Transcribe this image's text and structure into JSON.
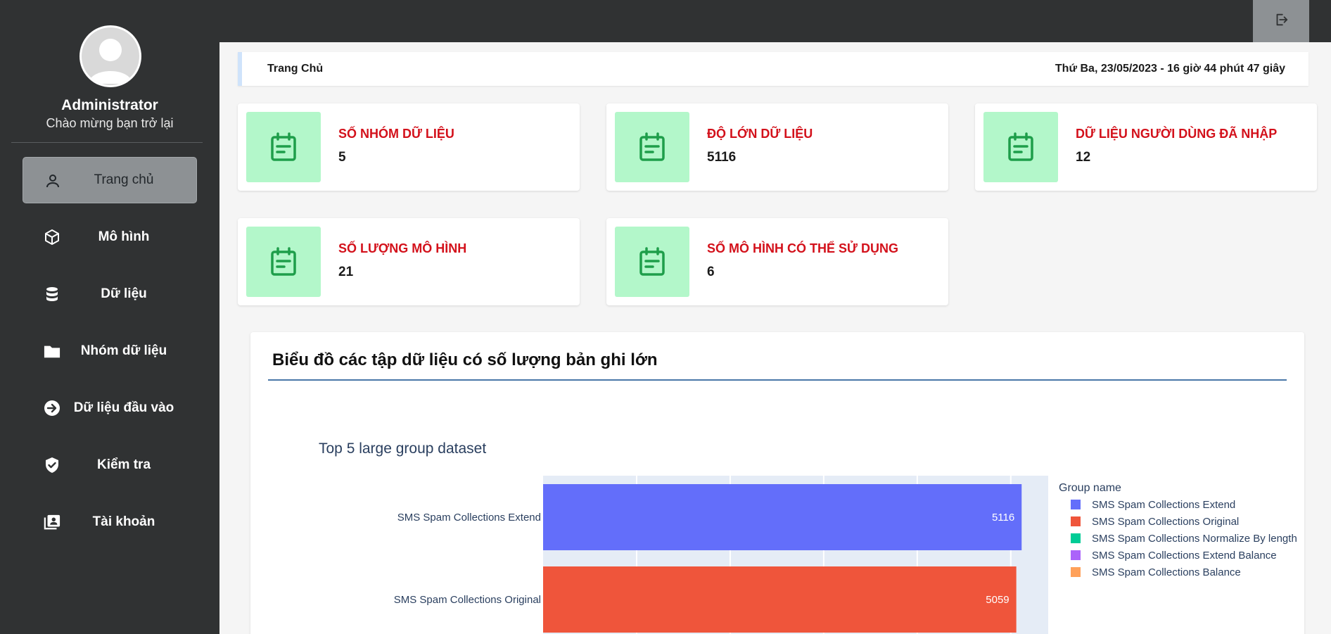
{
  "sidebar": {
    "admin_name": "Administrator",
    "welcome": "Chào mừng bạn trở lại",
    "items": [
      {
        "label": "Trang chủ",
        "icon": "user-icon",
        "active": true
      },
      {
        "label": "Mô hình",
        "icon": "cube-icon"
      },
      {
        "label": "Dữ liệu",
        "icon": "database-icon"
      },
      {
        "label": "Nhóm dữ liệu",
        "icon": "folder-icon"
      },
      {
        "label": "Dữ liệu đầu vào",
        "icon": "arrow-in-icon"
      },
      {
        "label": "Kiểm tra",
        "icon": "shield-check-icon"
      },
      {
        "label": "Tài khoản",
        "icon": "account-card-icon"
      }
    ]
  },
  "topbar": {
    "logout_icon": "logout-icon"
  },
  "breadcrumb": {
    "crumb": "Trang Chủ",
    "datetime": "Thứ Ba, 23/05/2023 - 16 giờ 44 phút 47 giây"
  },
  "stats": [
    {
      "title": "SỐ NHÓM DỮ LIỆU",
      "value": "5"
    },
    {
      "title": "ĐỘ LỚN DỮ LIỆU",
      "value": "5116"
    },
    {
      "title": "DỮ LIỆU NGƯỜI DÙNG ĐÃ NHẬP",
      "value": "12"
    },
    {
      "title": "SỐ LƯỢNG MÔ HÌNH",
      "value": "21"
    },
    {
      "title": "SỐ MÔ HÌNH CÓ THỂ SỬ DỤNG",
      "value": "6"
    }
  ],
  "colors": {
    "card_title": "#d3111b",
    "icon_bg": "#b3f7ca",
    "icon_fg": "#1e9e4a",
    "sidebar_bg": "#303233"
  },
  "chart_panel": {
    "title": "Biểu đồ các tập dữ liệu có số lượng bản ghi lớn"
  },
  "chart_data": {
    "type": "bar",
    "orientation": "horizontal",
    "title": "Top 5 large group dataset",
    "legend_title": "Group name",
    "legend_placement": "right",
    "grid": true,
    "xlim": [
      0,
      5400
    ],
    "categories": [
      "SMS Spam Collections Extend",
      "SMS Spam Collections Original"
    ],
    "values": [
      5116,
      5059
    ],
    "series": [
      {
        "name": "SMS Spam Collections Extend",
        "color": "#636efa"
      },
      {
        "name": "SMS Spam Collections Original",
        "color": "#ef553b"
      },
      {
        "name": "SMS Spam Collections Normalize By length",
        "color": "#00cc96"
      },
      {
        "name": "SMS Spam Collections Extend Balance",
        "color": "#ab63fa"
      },
      {
        "name": "SMS Spam Collections Balance",
        "color": "#ffa15a"
      }
    ]
  }
}
